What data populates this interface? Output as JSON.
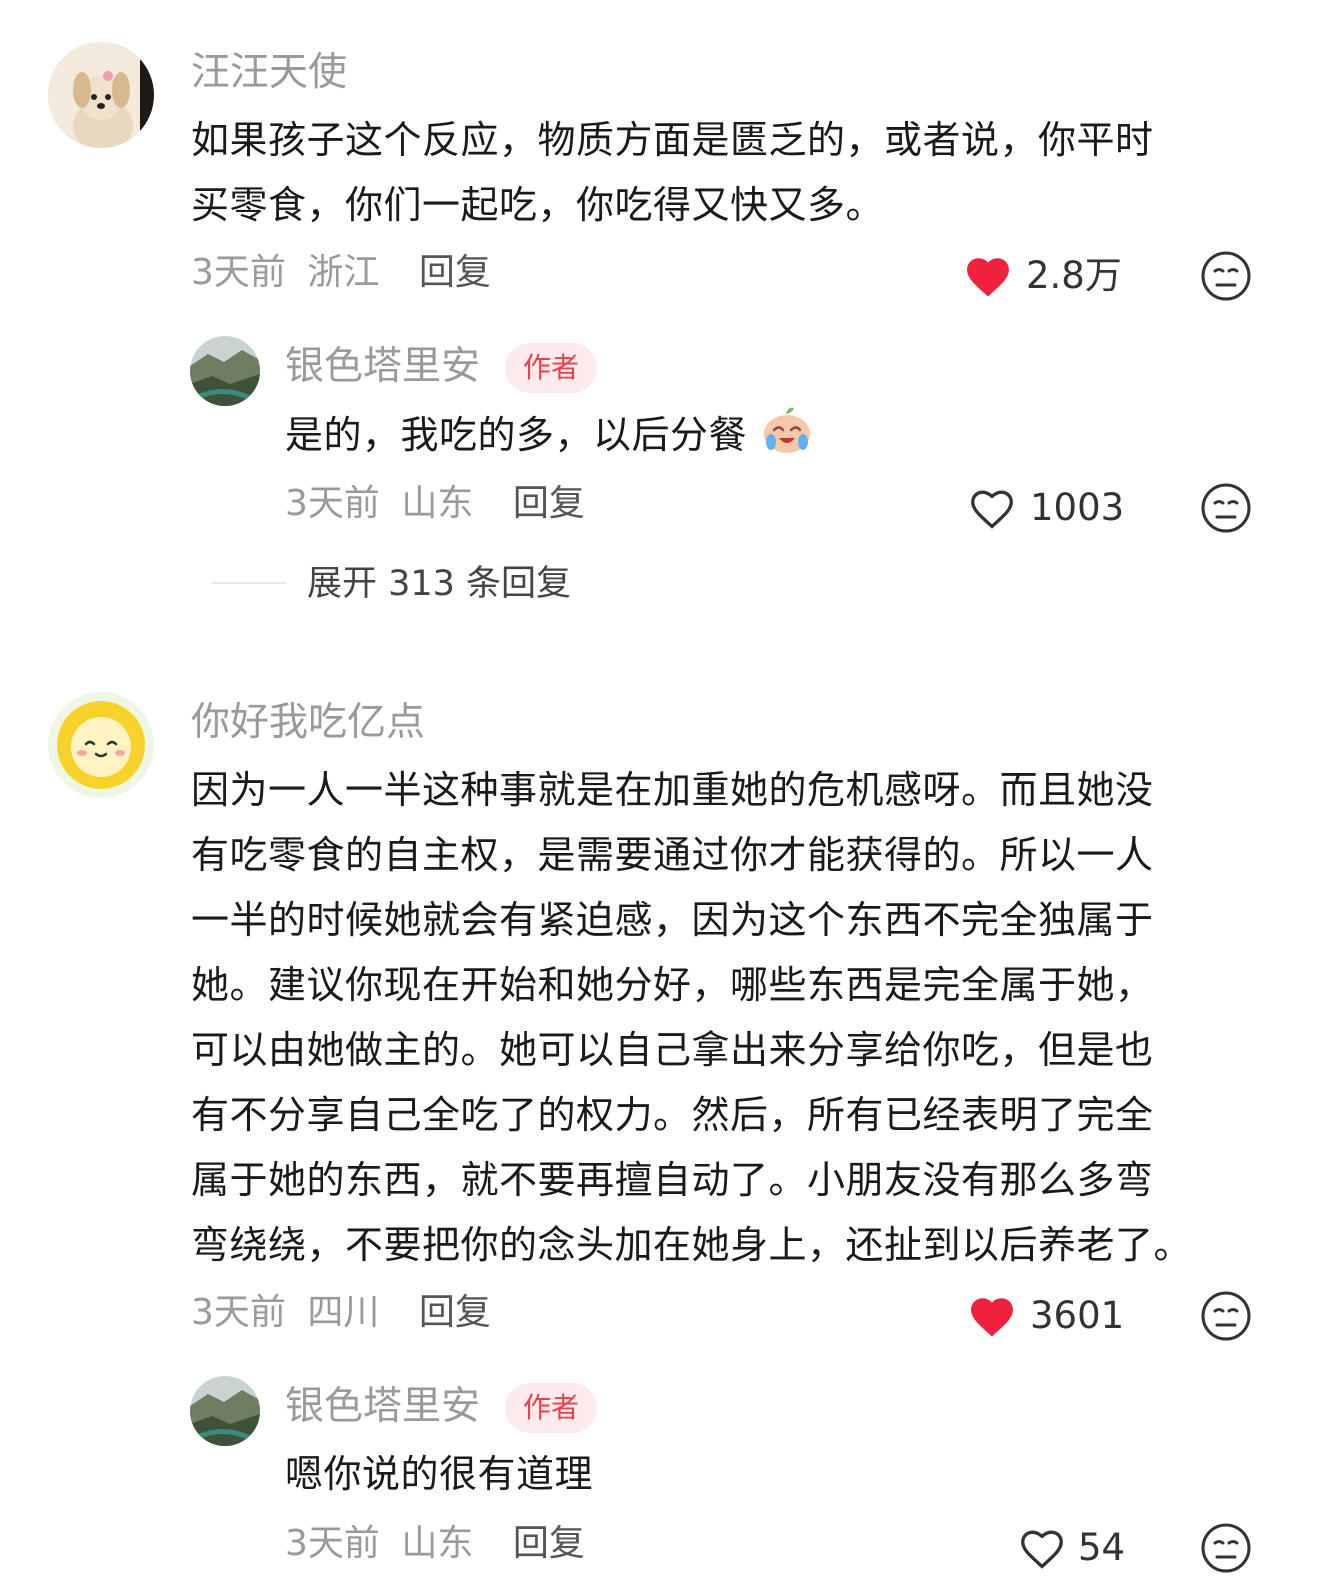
{
  "comments": [
    {
      "username": "汪汪天使",
      "text_lines": [
        "如果孩子这个反应，物质方面是匮乏的，或者说，你平时",
        "买零食，你们一起吃，你吃得又快又多。"
      ],
      "time": "3天前",
      "location": "浙江",
      "reply_label": "回复",
      "likes": "2.8万",
      "liked": true,
      "reply": {
        "username": "银色塔里安",
        "badge": "作者",
        "text": "是的，我吃的多，以后分餐",
        "time": "3天前",
        "location": "山东",
        "reply_label": "回复",
        "likes": "1003",
        "liked": false
      },
      "expand": "展开 313 条回复"
    },
    {
      "username": "你好我吃亿点",
      "text_lines": [
        "因为一人一半这种事就是在加重她的危机感呀。而且她没",
        "有吃零食的自主权，是需要通过你才能获得的。所以一人",
        "一半的时候她就会有紧迫感，因为这个东西不完全独属于",
        "她。建议你现在开始和她分好，哪些东西是完全属于她，",
        "可以由她做主的。她可以自己拿出来分享给你吃，但是也",
        "有不分享自己全吃了的权力。然后，所有已经表明了完全",
        "属于她的东西，就不要再擅自动了。小朋友没有那么多弯",
        "弯绕绕，不要把你的念头加在她身上，还扯到以后养老了。"
      ],
      "time": "3天前",
      "location": "四川",
      "reply_label": "回复",
      "likes": "3601",
      "liked": true,
      "reply": {
        "username": "银色塔里安",
        "badge": "作者",
        "text": "嗯你说的很有道理",
        "time": "3天前",
        "location": "山东",
        "reply_label": "回复",
        "likes": "54",
        "liked": false
      }
    }
  ],
  "icons": {
    "like_filled_color": "#f0213c",
    "like_outline_color": "#333333",
    "dislike_icon": "neutral-face-icon"
  }
}
